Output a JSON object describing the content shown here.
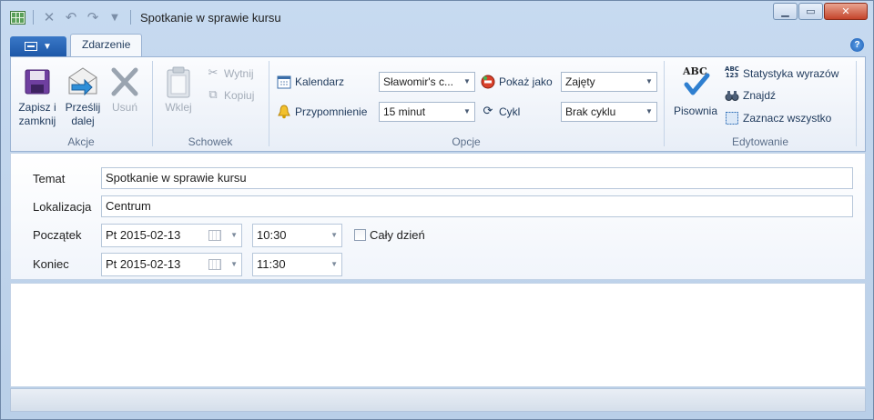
{
  "window": {
    "title": "Spotkanie w sprawie kursu"
  },
  "qat": {
    "icons": [
      "calendar-app-icon",
      "delete-icon",
      "undo-icon",
      "redo-icon",
      "customize-icon"
    ]
  },
  "tabs": {
    "event_label": "Zdarzenie"
  },
  "ribbon": {
    "akcje": {
      "label": "Akcje",
      "save_close_line1": "Zapisz i",
      "save_close_line2": "zamknij",
      "forward_line1": "Prześlij",
      "forward_line2": "dalej",
      "delete": "Usuń"
    },
    "schowek": {
      "label": "Schowek",
      "paste": "Wklej",
      "cut": "Wytnij",
      "copy": "Kopiuj"
    },
    "opcje": {
      "label": "Opcje",
      "calendar_label": "Kalendarz",
      "calendar_value": "Sławomir's c...",
      "reminder_label": "Przypomnienie",
      "reminder_value": "15 minut",
      "show_as_label": "Pokaż jako",
      "show_as_value": "Zajęty",
      "recurrence_label": "Cykl",
      "recurrence_value": "Brak cyklu"
    },
    "edytowanie": {
      "label": "Edytowanie",
      "spelling": "Pisownia",
      "word_count": "Statystyka wyrazów",
      "find": "Znajdź",
      "select_all": "Zaznacz wszystko"
    }
  },
  "form": {
    "subject_label": "Temat",
    "subject_value": "Spotkanie w sprawie kursu",
    "location_label": "Lokalizacja",
    "location_value": "Centrum",
    "start_label": "Początek",
    "start_date": "Pt 2015-02-13",
    "start_time": "10:30",
    "allday_label": "Cały dzień",
    "end_label": "Koniec",
    "end_date": "Pt 2015-02-13",
    "end_time": "11:30"
  },
  "colors": {
    "accent": "#1d58a8",
    "ribbon_bg": "#e8eef7",
    "label_text": "#1e395b"
  }
}
